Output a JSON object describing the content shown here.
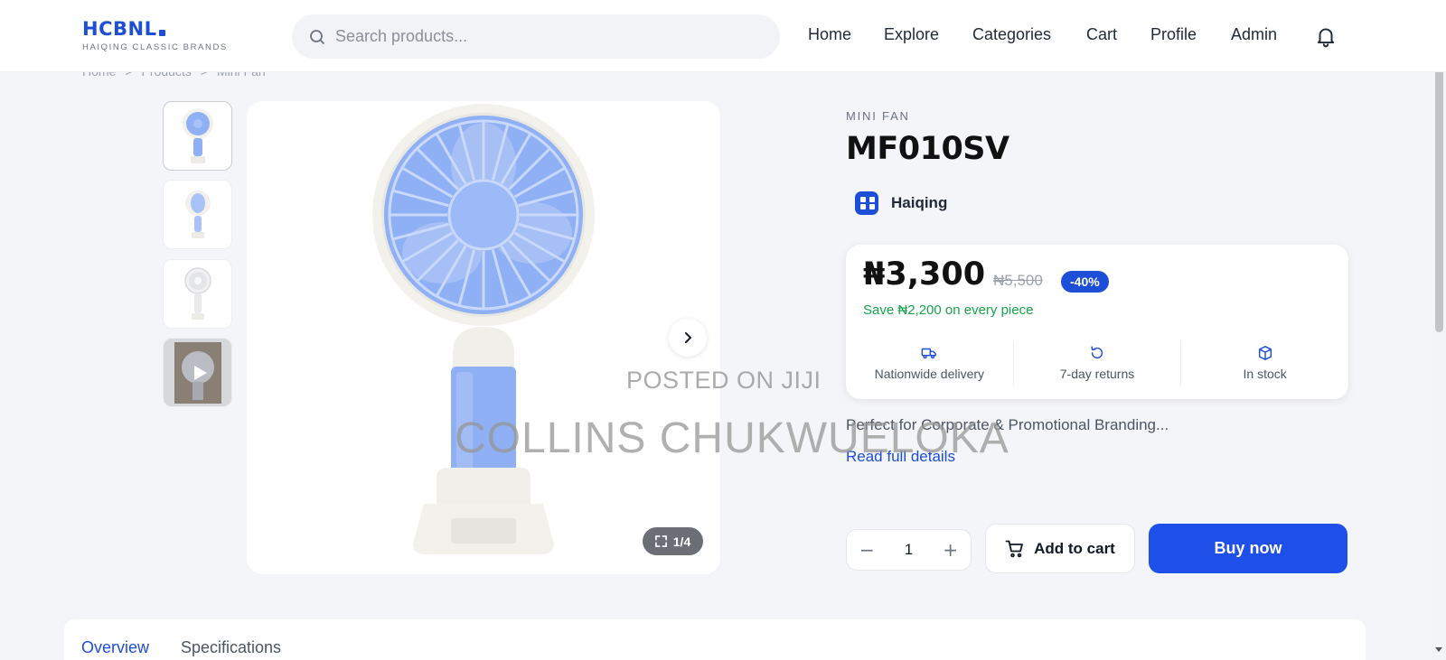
{
  "header": {
    "logo_text": "HCBNL",
    "logo_tagline": "HAIQING CLASSIC BRANDS",
    "search_placeholder": "Search products...",
    "nav": [
      {
        "label": "Home",
        "icon": "none"
      },
      {
        "label": "Explore",
        "icon": "none"
      },
      {
        "label": "Categories",
        "icon": "none"
      },
      {
        "label": "Cart",
        "icon": "none"
      },
      {
        "label": "Profile",
        "icon": "none"
      },
      {
        "label": "Admin",
        "icon": "none"
      }
    ],
    "bell_icon": "bell-icon"
  },
  "breadcrumb": {
    "items": [
      "Home",
      "Products",
      "Mini Fan"
    ],
    "separator": ">"
  },
  "gallery": {
    "thumbnails": [
      {
        "kind": "image",
        "active": true,
        "fan_color": "#8fb0f5"
      },
      {
        "kind": "image",
        "active": false,
        "fan_color": "#a9c2f7"
      },
      {
        "kind": "image",
        "active": false,
        "fan_color": "#d9dadd"
      },
      {
        "kind": "video",
        "active": false,
        "icon": "play-icon"
      }
    ],
    "counter": "1/4",
    "expand_icon": "expand-icon",
    "next_icon": "chevron-right-icon"
  },
  "product": {
    "category": "MINI FAN",
    "title": "MF010SV",
    "brand": "Haiqing",
    "price": "₦3,300",
    "old_price": "₦5,500",
    "discount": "-40%",
    "save_text": "Save ₦2,200 on every piece",
    "features": [
      {
        "label": "Nationwide delivery",
        "icon": "truck-icon"
      },
      {
        "label": "7-day returns",
        "icon": "return-icon"
      },
      {
        "label": "In stock",
        "icon": "box-icon"
      }
    ],
    "description": "Perfect for Corporate & Promotional Branding...",
    "read_more": "Read full details",
    "quantity": "1",
    "minus": "−",
    "plus": "+",
    "add_to_cart": "Add to cart",
    "buy_now": "Buy now"
  },
  "tabs": [
    {
      "label": "Overview",
      "active": true
    },
    {
      "label": "Specifications",
      "active": false
    }
  ],
  "watermark": {
    "line1": "POSTED ON JIJI",
    "line2": "COLLINS CHUKWUELOKA"
  },
  "colors": {
    "accent": "#1d4ed8",
    "save_green": "#16a34a",
    "fan_blue": "#8fb0f5"
  }
}
